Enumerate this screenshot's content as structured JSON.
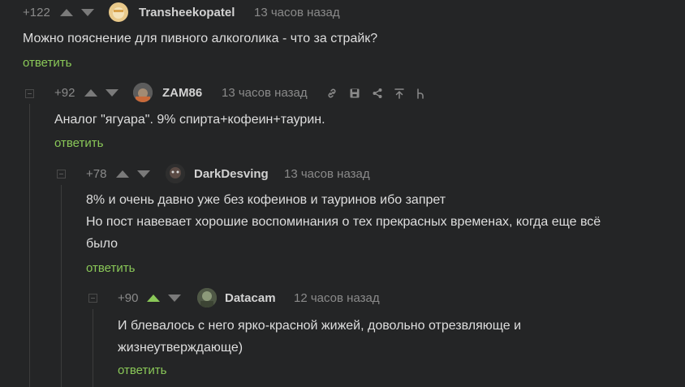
{
  "comments": [
    {
      "rating": "+122",
      "user": "Transheekopatel",
      "time": "13 часов назад",
      "lines": [
        "Можно пояснение для пивного алкоголика - что за страйк?"
      ],
      "reply": "ответить"
    },
    {
      "rating": "+92",
      "user": "ZAM86",
      "time": "13 часов назад",
      "lines": [
        "Аналог \"ягуара\". 9% спирта+кофеин+таурин."
      ],
      "reply": "ответить"
    },
    {
      "rating": "+78",
      "user": "DarkDesving",
      "time": "13 часов назад",
      "lines": [
        "8% и очень давно уже без кофеинов и тауринов ибо запрет",
        "Но пост навевает хорошие воспоминания о тех прекрасных временах, когда еще всё",
        "было"
      ],
      "reply": "ответить"
    },
    {
      "rating": "+90",
      "user": "Datacam",
      "time": "12 часов назад",
      "lines": [
        "И блевалось с него ярко-красной жижей, довольно отрезвляюще и",
        "жизнеутверждающе)"
      ],
      "reply": "ответить"
    }
  ],
  "tools": [
    "link-icon",
    "save-icon",
    "share-icon",
    "scroll-up-icon",
    "branch-icon"
  ],
  "colors": {
    "background": "#242526",
    "accent": "#8ac858",
    "text": "#dedede",
    "muted": "#8a8a8a"
  }
}
